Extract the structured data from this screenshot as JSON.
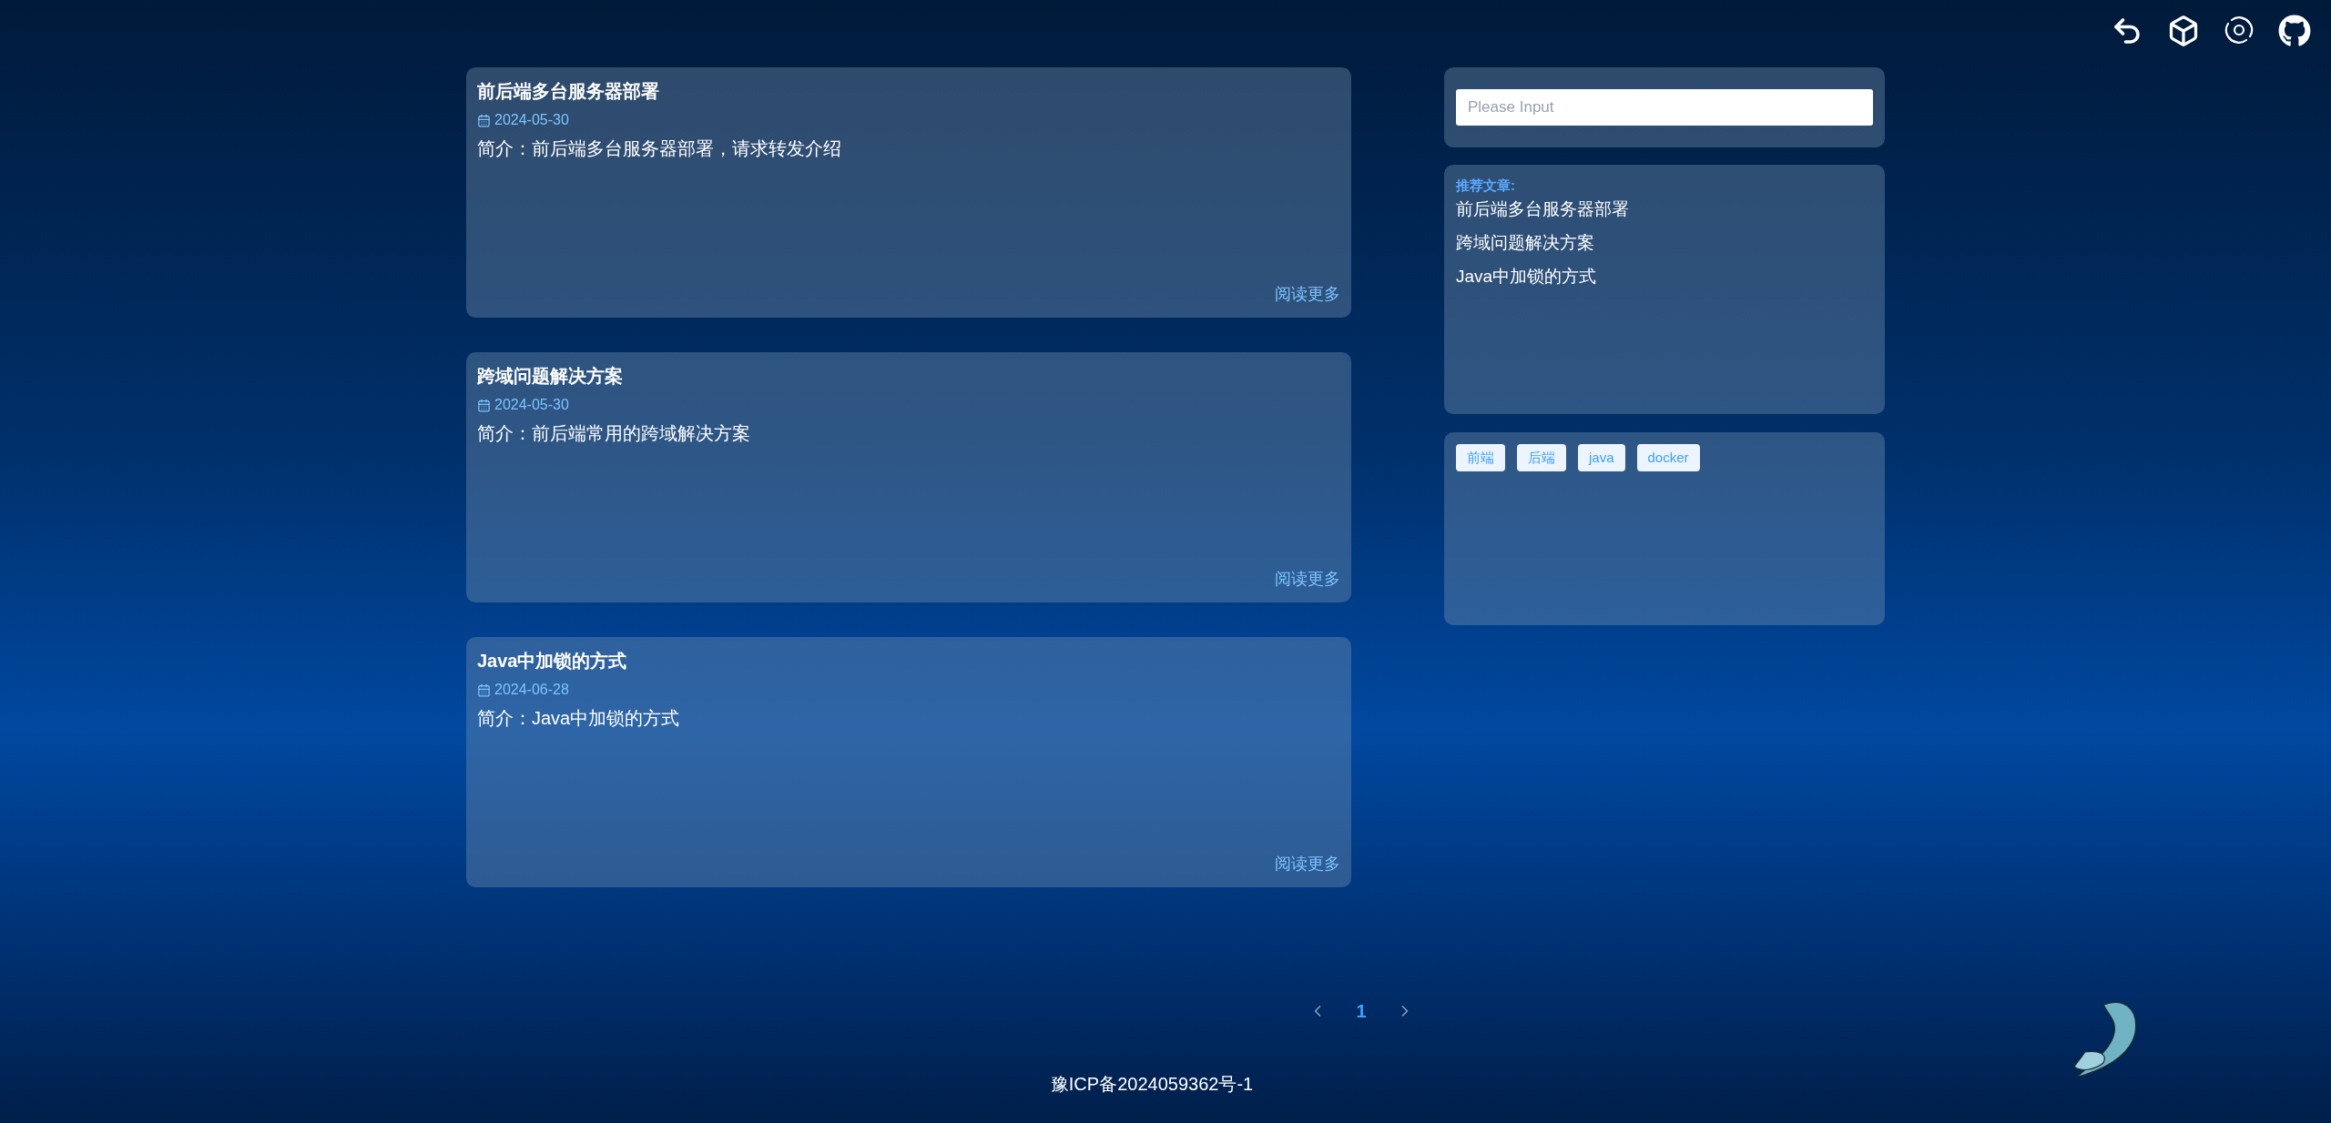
{
  "articles": [
    {
      "title": "前后端多台服务器部署",
      "date": "2024-05-30",
      "summary": "简介：前后端多台服务器部署，请求转发介绍",
      "read_more": "阅读更多"
    },
    {
      "title": "跨域问题解决方案",
      "date": "2024-05-30",
      "summary": "简介：前后端常用的跨域解决方案",
      "read_more": "阅读更多"
    },
    {
      "title": "Java中加锁的方式",
      "date": "2024-06-28",
      "summary": "简介：Java中加锁的方式",
      "read_more": "阅读更多"
    }
  ],
  "search": {
    "placeholder": "Please Input"
  },
  "recommended": {
    "heading": "推荐文章:",
    "items": [
      "前后端多台服务器部署",
      "跨域问题解决方案",
      "Java中加锁的方式"
    ]
  },
  "tags": [
    "前端",
    "后端",
    "java",
    "docker"
  ],
  "pagination": {
    "pages": [
      {
        "label": "1",
        "selected": true
      }
    ]
  },
  "footer": {
    "icp": "豫ICP备2024059362号-1"
  }
}
